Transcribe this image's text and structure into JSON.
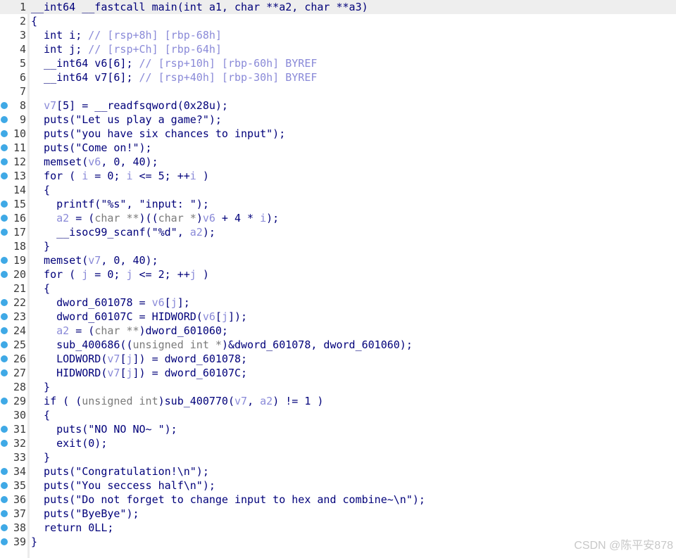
{
  "lines": [
    {
      "n": "1",
      "bp": false,
      "hl": true,
      "segs": [
        [
          "",
          "__int64 __fastcall main(int a1, char **a2, char **a3)"
        ]
      ]
    },
    {
      "n": "2",
      "bp": false,
      "hl": false,
      "segs": [
        [
          "",
          "{"
        ]
      ]
    },
    {
      "n": "3",
      "bp": false,
      "hl": false,
      "segs": [
        [
          "",
          "  int i; "
        ],
        [
          "c",
          "// [rsp+8h] [rbp-68h]"
        ]
      ]
    },
    {
      "n": "4",
      "bp": false,
      "hl": false,
      "segs": [
        [
          "",
          "  int j; "
        ],
        [
          "c",
          "// [rsp+Ch] [rbp-64h]"
        ]
      ]
    },
    {
      "n": "5",
      "bp": false,
      "hl": false,
      "segs": [
        [
          "",
          "  __int64 v6[6]; "
        ],
        [
          "c",
          "// [rsp+10h] [rbp-60h] BYREF"
        ]
      ]
    },
    {
      "n": "6",
      "bp": false,
      "hl": false,
      "segs": [
        [
          "",
          "  __int64 v7[6]; "
        ],
        [
          "c",
          "// [rsp+40h] [rbp-30h] BYREF"
        ]
      ]
    },
    {
      "n": "7",
      "bp": false,
      "hl": false,
      "segs": [
        [
          "",
          ""
        ]
      ]
    },
    {
      "n": "8",
      "bp": true,
      "hl": false,
      "segs": [
        [
          "",
          "  "
        ],
        [
          "v",
          "v7"
        ],
        [
          "",
          "[5] = __readfsqword(0x28u);"
        ]
      ]
    },
    {
      "n": "9",
      "bp": true,
      "hl": false,
      "segs": [
        [
          "",
          "  puts(\"Let us play a game?\");"
        ]
      ]
    },
    {
      "n": "10",
      "bp": true,
      "hl": false,
      "segs": [
        [
          "",
          "  puts(\"you have six chances to input\");"
        ]
      ]
    },
    {
      "n": "11",
      "bp": true,
      "hl": false,
      "segs": [
        [
          "",
          "  puts(\"Come on!\");"
        ]
      ]
    },
    {
      "n": "12",
      "bp": true,
      "hl": false,
      "segs": [
        [
          "",
          "  memset("
        ],
        [
          "v",
          "v6"
        ],
        [
          "",
          ", 0, 40);"
        ]
      ]
    },
    {
      "n": "13",
      "bp": true,
      "hl": false,
      "segs": [
        [
          "",
          "  for ( "
        ],
        [
          "v",
          "i"
        ],
        [
          "",
          " = 0; "
        ],
        [
          "v",
          "i"
        ],
        [
          "",
          " <= 5; ++"
        ],
        [
          "v",
          "i"
        ],
        [
          "",
          " )"
        ]
      ]
    },
    {
      "n": "14",
      "bp": false,
      "hl": false,
      "segs": [
        [
          "",
          "  {"
        ]
      ]
    },
    {
      "n": "15",
      "bp": true,
      "hl": false,
      "segs": [
        [
          "",
          "    printf(\"%s\", \"input: \");"
        ]
      ]
    },
    {
      "n": "16",
      "bp": true,
      "hl": false,
      "segs": [
        [
          "",
          "    "
        ],
        [
          "v",
          "a2"
        ],
        [
          "",
          " = ("
        ],
        [
          "t",
          "char **"
        ],
        [
          "",
          ")(("
        ],
        [
          "t",
          "char *"
        ],
        [
          "",
          ")"
        ],
        [
          "v",
          "v6"
        ],
        [
          "",
          " + 4 * "
        ],
        [
          "v",
          "i"
        ],
        [
          "",
          ");"
        ]
      ]
    },
    {
      "n": "17",
      "bp": true,
      "hl": false,
      "segs": [
        [
          "",
          "    __isoc99_scanf(\"%d\", "
        ],
        [
          "v",
          "a2"
        ],
        [
          "",
          ");"
        ]
      ]
    },
    {
      "n": "18",
      "bp": false,
      "hl": false,
      "segs": [
        [
          "",
          "  }"
        ]
      ]
    },
    {
      "n": "19",
      "bp": true,
      "hl": false,
      "segs": [
        [
          "",
          "  memset("
        ],
        [
          "v",
          "v7"
        ],
        [
          "",
          ", 0, 40);"
        ]
      ]
    },
    {
      "n": "20",
      "bp": true,
      "hl": false,
      "segs": [
        [
          "",
          "  for ( "
        ],
        [
          "v",
          "j"
        ],
        [
          "",
          " = 0; "
        ],
        [
          "v",
          "j"
        ],
        [
          "",
          " <= 2; ++"
        ],
        [
          "v",
          "j"
        ],
        [
          "",
          " )"
        ]
      ]
    },
    {
      "n": "21",
      "bp": false,
      "hl": false,
      "segs": [
        [
          "",
          "  {"
        ]
      ]
    },
    {
      "n": "22",
      "bp": true,
      "hl": false,
      "segs": [
        [
          "",
          "    dword_601078 = "
        ],
        [
          "v",
          "v6"
        ],
        [
          "",
          "["
        ],
        [
          "v",
          "j"
        ],
        [
          "",
          "];"
        ]
      ]
    },
    {
      "n": "23",
      "bp": true,
      "hl": false,
      "segs": [
        [
          "",
          "    dword_60107C = HIDWORD("
        ],
        [
          "v",
          "v6"
        ],
        [
          "",
          "["
        ],
        [
          "v",
          "j"
        ],
        [
          "",
          "]);"
        ]
      ]
    },
    {
      "n": "24",
      "bp": true,
      "hl": false,
      "segs": [
        [
          "",
          "    "
        ],
        [
          "v",
          "a2"
        ],
        [
          "",
          " = ("
        ],
        [
          "t",
          "char **"
        ],
        [
          "",
          ")dword_601060;"
        ]
      ]
    },
    {
      "n": "25",
      "bp": true,
      "hl": false,
      "segs": [
        [
          "",
          "    sub_400686(("
        ],
        [
          "t",
          "unsigned int *"
        ],
        [
          "",
          ")&dword_601078, dword_601060);"
        ]
      ]
    },
    {
      "n": "26",
      "bp": true,
      "hl": false,
      "segs": [
        [
          "",
          "    LODWORD("
        ],
        [
          "v",
          "v7"
        ],
        [
          "",
          "["
        ],
        [
          "v",
          "j"
        ],
        [
          "",
          "]) = dword_601078;"
        ]
      ]
    },
    {
      "n": "27",
      "bp": true,
      "hl": false,
      "segs": [
        [
          "",
          "    HIDWORD("
        ],
        [
          "v",
          "v7"
        ],
        [
          "",
          "["
        ],
        [
          "v",
          "j"
        ],
        [
          "",
          "]) = dword_60107C;"
        ]
      ]
    },
    {
      "n": "28",
      "bp": false,
      "hl": false,
      "segs": [
        [
          "",
          "  }"
        ]
      ]
    },
    {
      "n": "29",
      "bp": true,
      "hl": false,
      "segs": [
        [
          "",
          "  if ( ("
        ],
        [
          "t",
          "unsigned int"
        ],
        [
          "",
          ")sub_400770("
        ],
        [
          "v",
          "v7"
        ],
        [
          "",
          ", "
        ],
        [
          "v",
          "a2"
        ],
        [
          "",
          ") != 1 )"
        ]
      ]
    },
    {
      "n": "30",
      "bp": false,
      "hl": false,
      "segs": [
        [
          "",
          "  {"
        ]
      ]
    },
    {
      "n": "31",
      "bp": true,
      "hl": false,
      "segs": [
        [
          "",
          "    puts(\"NO NO NO~ \");"
        ]
      ]
    },
    {
      "n": "32",
      "bp": true,
      "hl": false,
      "segs": [
        [
          "",
          "    exit(0);"
        ]
      ]
    },
    {
      "n": "33",
      "bp": false,
      "hl": false,
      "segs": [
        [
          "",
          "  }"
        ]
      ]
    },
    {
      "n": "34",
      "bp": true,
      "hl": false,
      "segs": [
        [
          "",
          "  puts(\"Congratulation!\\n\");"
        ]
      ]
    },
    {
      "n": "35",
      "bp": true,
      "hl": false,
      "segs": [
        [
          "",
          "  puts(\"You seccess half\\n\");"
        ]
      ]
    },
    {
      "n": "36",
      "bp": true,
      "hl": false,
      "segs": [
        [
          "",
          "  puts(\"Do not forget to change input to hex and combine~\\n\");"
        ]
      ]
    },
    {
      "n": "37",
      "bp": true,
      "hl": false,
      "segs": [
        [
          "",
          "  puts(\"ByeBye\");"
        ]
      ]
    },
    {
      "n": "38",
      "bp": true,
      "hl": false,
      "segs": [
        [
          "",
          "  return 0LL;"
        ]
      ]
    },
    {
      "n": "39",
      "bp": true,
      "hl": false,
      "segs": [
        [
          "",
          "}"
        ]
      ]
    }
  ],
  "watermark": "CSDN @陈平安878",
  "colors": {
    "code": "#00007a",
    "variable": "#8a8ad8",
    "comment": "#8a8ad8",
    "type_cast": "#7a7a7a",
    "breakpoint": "#3fa9e6",
    "current_line_highlight": "#eeeeee"
  },
  "icons": {
    "breakpoint": "breakpoint-dot-icon"
  }
}
